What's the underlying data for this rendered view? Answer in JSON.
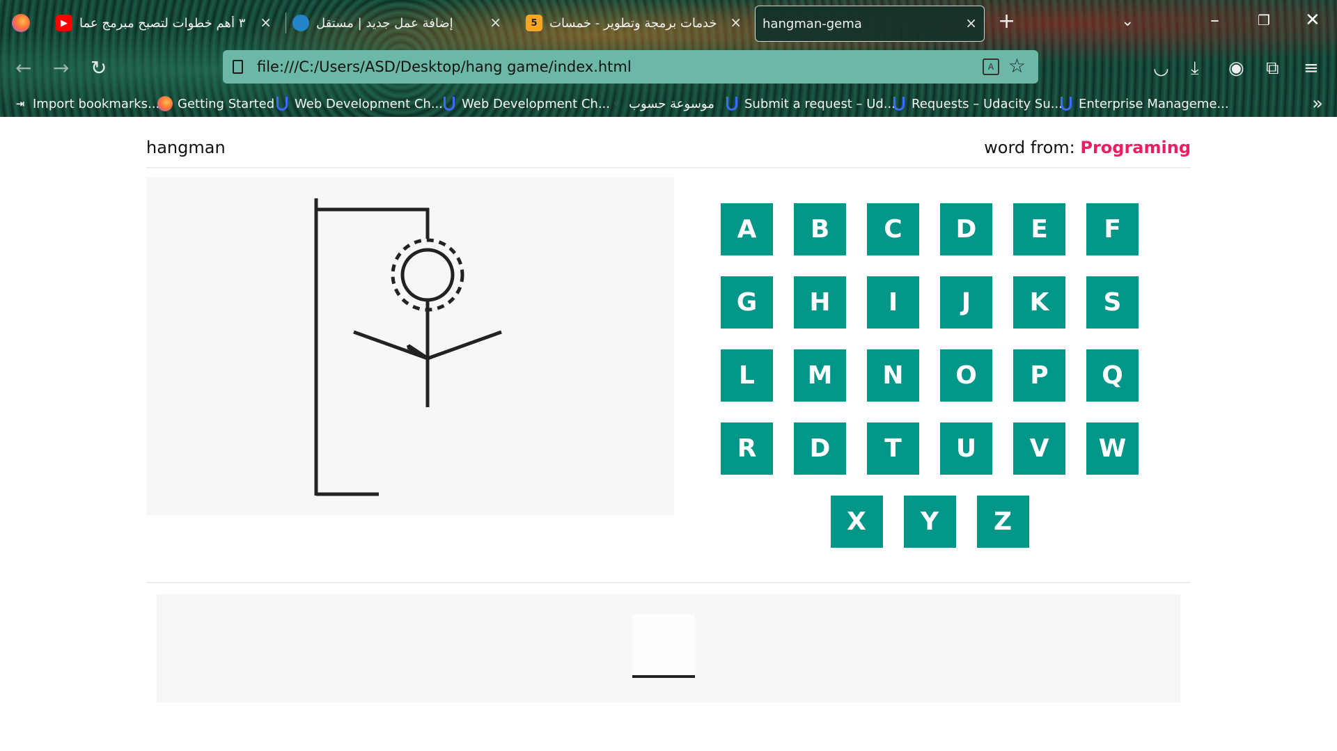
{
  "browser": {
    "tabs": [
      {
        "title": "٣ أهم خطوات لتصبح مبرمج عما",
        "icon": "youtube-icon",
        "active": false
      },
      {
        "title": "إضافة عمل جديد | مستقل",
        "icon": "mostaql-icon",
        "active": false
      },
      {
        "title": "خدمات برمجة وتطوير - خمسات",
        "icon": "khamsat-icon",
        "active": false
      },
      {
        "title": "hangman-gema",
        "icon": "",
        "active": true
      }
    ],
    "url": "file:///C:/Users/ASD/Desktop/hang game/index.html",
    "bookmarks": [
      {
        "label": "Import bookmarks...",
        "icon": "import-icon"
      },
      {
        "label": "Getting Started",
        "icon": "firefox-icon"
      },
      {
        "label": "Web Development Ch...",
        "icon": "udacity-icon"
      },
      {
        "label": "Web Development Ch...",
        "icon": "udacity-icon"
      },
      {
        "label": "موسوعة حسوب",
        "icon": "hsoub-icon"
      },
      {
        "label": "Submit a request – Ud...",
        "icon": "udacity-icon"
      },
      {
        "label": "Requests – Udacity Su...",
        "icon": "udacity-icon"
      },
      {
        "label": "Enterprise Manageme...",
        "icon": "udacity-icon"
      }
    ],
    "khamsat_badge": "5"
  },
  "game": {
    "title": "hangman",
    "word_from_label": "word from:",
    "category": "Programing",
    "letters": [
      "A",
      "B",
      "C",
      "D",
      "E",
      "F",
      "G",
      "H",
      "I",
      "J",
      "K",
      "S",
      "L",
      "M",
      "N",
      "O",
      "P",
      "Q",
      "R",
      "D",
      "T",
      "U",
      "V",
      "W",
      "X",
      "Y",
      "Z"
    ],
    "guess_slots": [
      ""
    ]
  },
  "colors": {
    "letter_bg": "#009688",
    "category": "#e91e63",
    "panel_bg": "#f7f7f7"
  }
}
